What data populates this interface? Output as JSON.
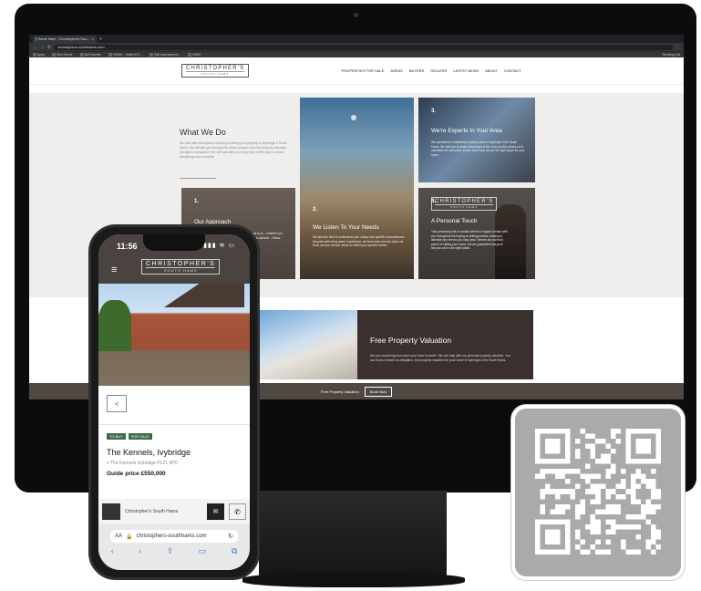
{
  "browser": {
    "tab_title": "Home New - Christophers Sou...",
    "tab_close": "×",
    "new_tab": "+",
    "url": "christophers-southhams.com",
    "bookmarks": [
      "Apps",
      "Xtra Server",
      "NetTransfer",
      "HOME - SwithLEO...",
      "Self Assessment...",
      "HSBC"
    ],
    "reading_list": "Reading List"
  },
  "site": {
    "logo_main": "CHRISTOPHER'S",
    "logo_sub": "SOUTH HAMS",
    "menu": [
      "PROPERTIES FOR SALE",
      "AREAS",
      "BUYERS",
      "SELLERS",
      "LATEST NEWS",
      "ABOUT",
      "CONTACT"
    ],
    "what_we_do": {
      "title": "What We Do",
      "body": "We look after all aspects of buying & selling your property in Ivybridge & South Hams. We will take you through the whole process from the property valuation through to completion. We will look after you every step of the way to ensure everything runs smoothly."
    },
    "cards": [
      {
        "num": "1.",
        "title": "Our Approach",
        "body": "...focus is on ...whether you ...time to achieve ...Hams."
      },
      {
        "num": "2.",
        "title": "We Listen To Your Needs",
        "body": "We take the time to understand your unique and specific circumstances because with many years' experience, we know that one size does not fit all, and our service needs to reflect your specific needs."
      },
      {
        "num": "3.",
        "title": "We're Experts In Your Area",
        "body": "We specialise in residential property sales in Ivybridge & the South Hams. We have an in depth knowledge of the area and this allows us to maximise the sale price of your home and secure the right buyer for your home."
      },
      {
        "num": "4.",
        "title": "A Personal Touch",
        "body": "Your personal point of contact will be in regular contact with you throughout the buying or selling process, helping to alleviate any nerves you may have. Nerves are part and parcel of selling your home, but we guarantee that you'll find you are in the right hands."
      }
    ],
    "valuation": {
      "title": "Free Property Valuation",
      "body": "Are you wondering how much your home is worth? We can help with our personal property valuation. You can book a trusted no-obligation, free property valuation for your home in Ivybridge & the South Hams."
    },
    "banner": {
      "text": "Free Property Valuation",
      "button": "Book Now"
    }
  },
  "phone": {
    "time": "11:56",
    "status_icons": "▮▮▮ ≋ ▭",
    "menu_icon": "≡",
    "logo_main": "CHRISTOPHER'S",
    "logo_sub": "SOUTH HAMS",
    "share_icon": "≺",
    "tags": [
      "TO BUY",
      "FOR SALE"
    ],
    "property_title": "The Kennels, Ivybridge",
    "property_address": "The Kennels Ivybridge PL21 9PD",
    "price": "Guide price £550,000",
    "agent_name": "Christopher's South Hams",
    "mail_icon": "✉",
    "call_icon": "✆",
    "safari_aa": "AA",
    "safari_url": "christophers-southhams.com",
    "reload_icon": "↻",
    "nav_icons": [
      "‹",
      "›",
      "⇪",
      "▭",
      "⧉"
    ]
  },
  "colors": {
    "header_brown": "#4a4340",
    "panel_dark": "#3a302d",
    "banner": "#504843",
    "tag_green": "#3d6b4a",
    "qr_grey": "#aaaaaa"
  }
}
